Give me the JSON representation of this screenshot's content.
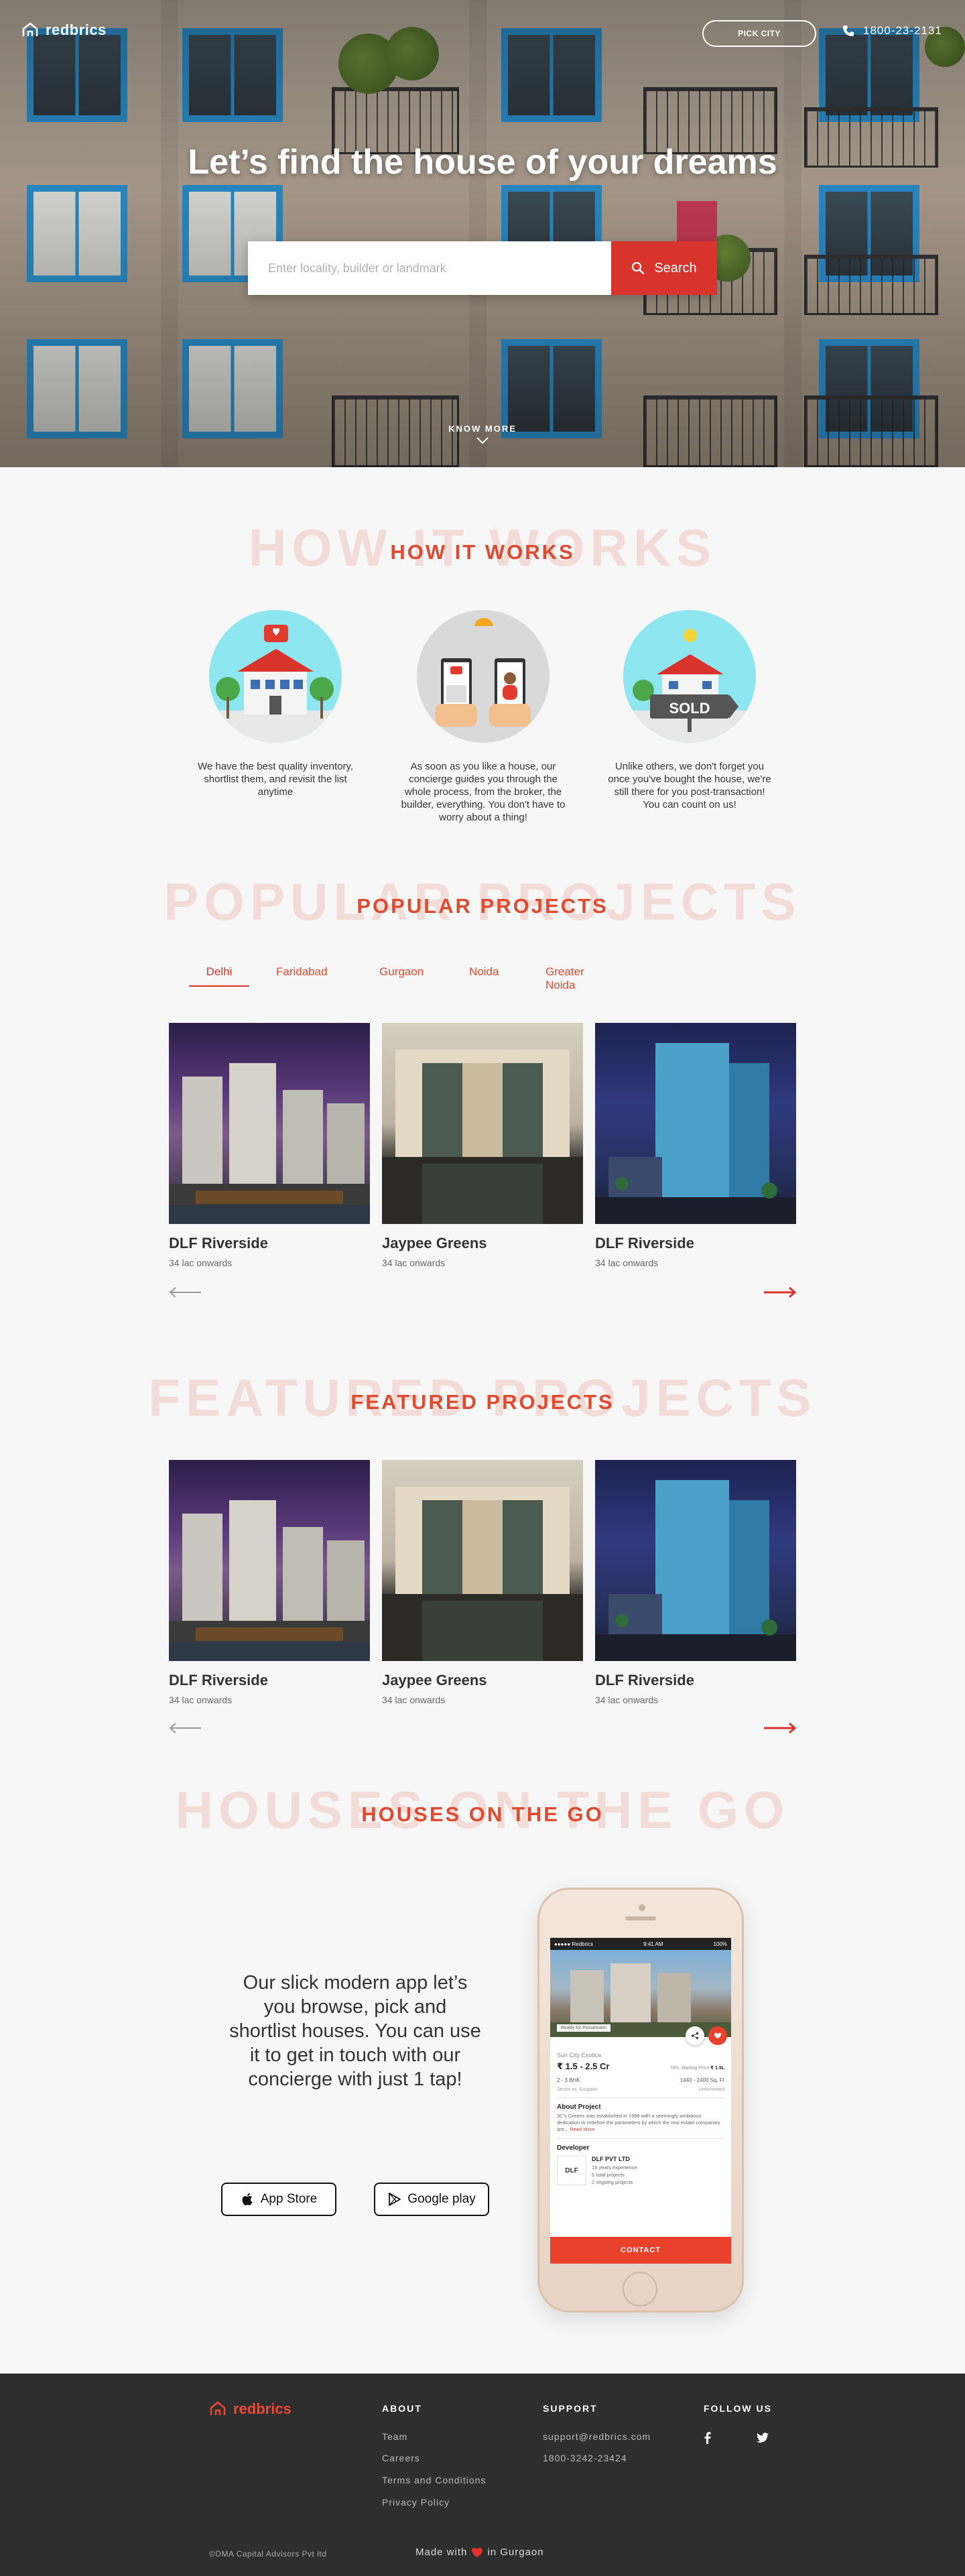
{
  "header": {
    "brand": "redbrics",
    "pick_city_label": "PICK CITY",
    "phone": "1800-23-2131"
  },
  "hero": {
    "title": "Let’s find the house of your dreams",
    "search_placeholder": "Enter locality, builder or landmark",
    "search_button": "Search",
    "know_more": "KNOW MORE"
  },
  "how_it_works": {
    "bg_title": "HOW IT WORKS",
    "title": "HOW IT WORKS",
    "steps": [
      {
        "icon": "house-heart-icon",
        "text": "We have the best quality inventory, shortlist them, and revisit the list anytime"
      },
      {
        "icon": "phones-chat-icon",
        "text": "As soon as you like a house, our concierge guides you through the whole process, from the broker, the builder, everything. You don't have to worry about a thing!"
      },
      {
        "icon": "sold-sign-icon",
        "badge": "SOLD",
        "text": "Unlike others, we don't forget you once you've bought the house, we're still there for you post-transaction! You can count on us!"
      }
    ]
  },
  "popular_projects": {
    "bg_title": "POPULAR PROJECTS",
    "title": "POPULAR PROJECTS",
    "tabs": [
      "Delhi",
      "Faridabad",
      "Gurgaon",
      "Noida",
      "Greater Noida"
    ],
    "active_tab": "Delhi",
    "cards": [
      {
        "name": "DLF Riverside",
        "price": "34 lac onwards"
      },
      {
        "name": "Jaypee Greens",
        "price": "34 lac onwards"
      },
      {
        "name": "DLF Riverside",
        "price": "34 lac onwards"
      }
    ]
  },
  "featured_projects": {
    "bg_title": "FEATURED PROJECTS",
    "title": "FEATURED PROJECTS",
    "cards": [
      {
        "name": "DLF Riverside",
        "price": "34 lac onwards"
      },
      {
        "name": "Jaypee Greens",
        "price": "34 lac onwards"
      },
      {
        "name": "DLF Riverside",
        "price": "34 lac onwards"
      }
    ]
  },
  "houses_on_the_go": {
    "bg_title": "HOUSES ON THE GO",
    "title": "HOUSES ON THE GO",
    "text": "Our slick modern app let’s you browse, pick and shortlist houses. You can use it to get in touch with our concierge with just 1 tap!",
    "app_store": "App Store",
    "google_play": "Google play",
    "phone_screen": {
      "status_left": "●●●●● Redbrics",
      "status_time": "9:41 AM",
      "status_right": "100%",
      "ready_badge": "Ready for Possession",
      "project": "Sun City Exotica",
      "price": "₹ 1.5 - 2.5 Cr",
      "price_note": "DPL Starting Price",
      "price_alt": "₹ 1.5L",
      "bhk": "2 - 3 BHK",
      "area": "1440 - 2400 Sq. Ft",
      "location": "Sector xx, Gurgaon",
      "furnish": "Unfurnished",
      "about_title": "About Project",
      "about_text": "3C's Greens was established in 1998 with a seemingly ambitious dedication to redefine the parameters by which the real estate companies are...",
      "read_more": "Read More",
      "developer_title": "Developer",
      "developer_name": "DLF PVT LTD",
      "dev_stats": [
        "15 years experience",
        "5 total projects",
        "2 ongoing projects"
      ],
      "contact": "CONTACT"
    }
  },
  "footer": {
    "brand": "redbrics",
    "about_title": "ABOUT",
    "about_links": [
      "Team",
      "Careers",
      "Terms and Conditions",
      "Privacy Policy"
    ],
    "support_title": "SUPPORT",
    "support_email": "support@redbrics.com",
    "support_phone": "1800-3242-23424",
    "follow_title": "FOLLOW US",
    "copyright": "©DMA Capital Advisors Pvt ltd",
    "made_with": "Made with",
    "made_in": "in Gurgaon"
  },
  "colors": {
    "accent": "#e04a2f",
    "button_red": "#d9342b",
    "footer_bg": "#2e2e2e",
    "window_blue": "#2a8bc7"
  }
}
